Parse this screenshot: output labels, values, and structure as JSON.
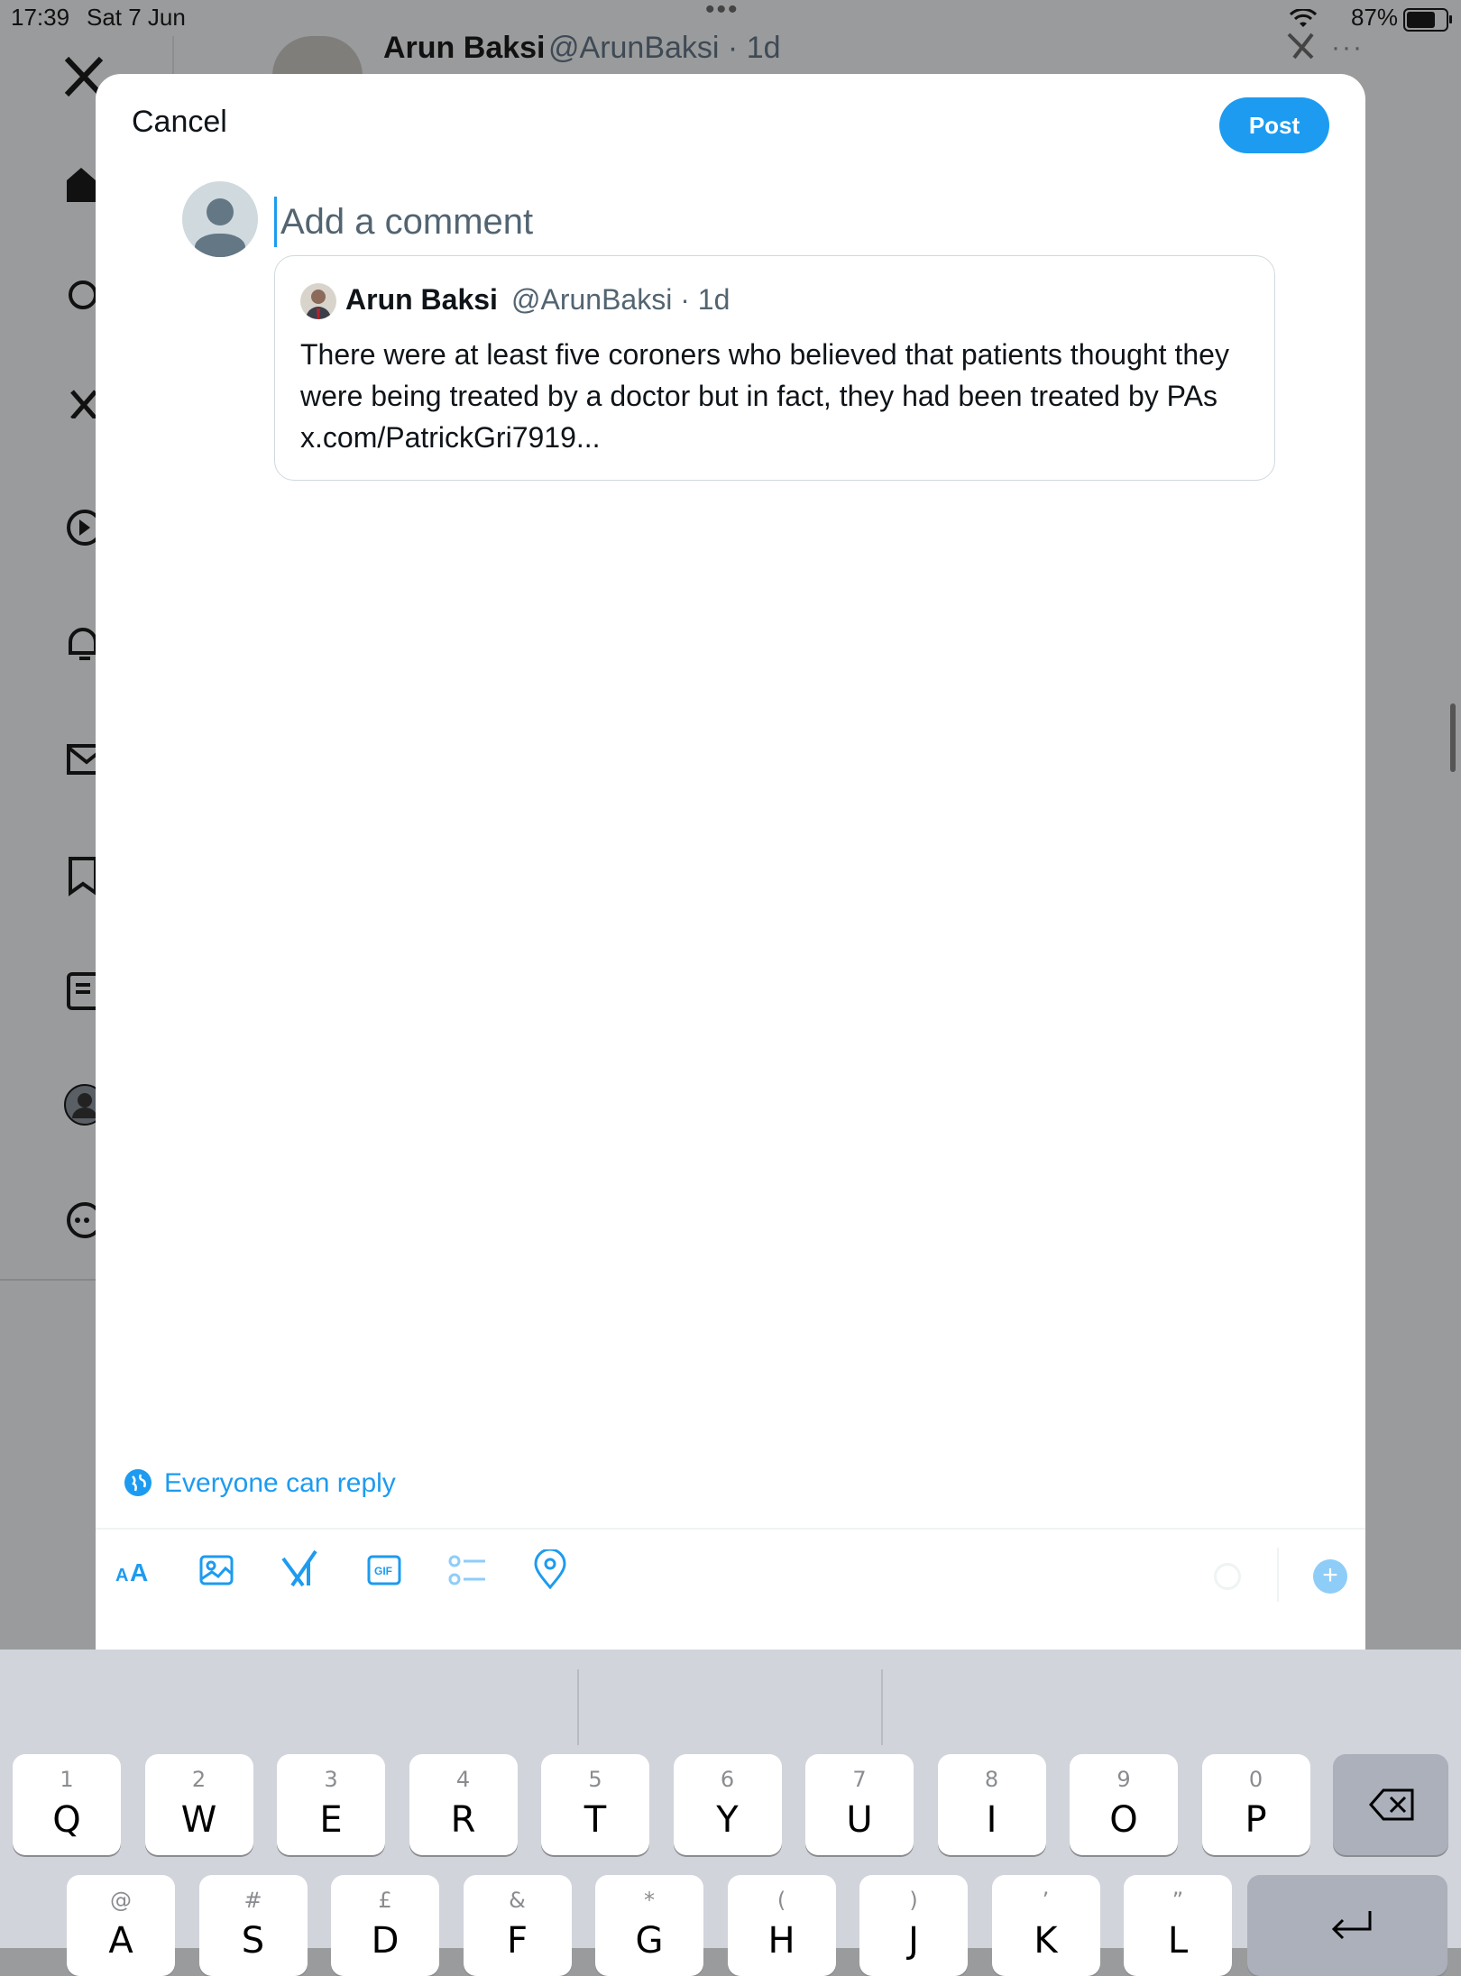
{
  "status_bar": {
    "time": "17:39",
    "date": "Sat 7 Jun",
    "battery_percent": "87%",
    "battery_level": 0.87
  },
  "background_post": {
    "author_name": "Arun Baksi",
    "author_handle": "@ArunBaksi · 1d",
    "more": "···"
  },
  "sidebar": {
    "items": [
      "x-logo-icon",
      "home-icon",
      "search-icon",
      "grok-icon",
      "video-icon",
      "notifications-icon",
      "messages-icon",
      "bookmarks-icon",
      "lists-icon",
      "profile-icon",
      "more-icon"
    ]
  },
  "composer": {
    "cancel_label": "Cancel",
    "post_label": "Post",
    "placeholder": "Add a comment",
    "quoted_post": {
      "author_name": "Arun Baksi",
      "author_handle": "@ArunBaksi · 1d",
      "text": "There were at least five coroners who believed that patients thought they were being treated by a doctor but in fact, they had been treated by PAs x.com/PatrickGri7919..."
    },
    "reply_setting": "Everyone can reply",
    "toolbar": [
      "text-format-icon",
      "image-icon",
      "grok-icon",
      "gif-icon",
      "poll-icon",
      "location-icon"
    ],
    "accent_color": "#1d9bf0"
  },
  "keyboard": {
    "row1": [
      {
        "hint": "1",
        "key": "Q"
      },
      {
        "hint": "2",
        "key": "W"
      },
      {
        "hint": "3",
        "key": "E"
      },
      {
        "hint": "4",
        "key": "R"
      },
      {
        "hint": "5",
        "key": "T"
      },
      {
        "hint": "6",
        "key": "Y"
      },
      {
        "hint": "7",
        "key": "U"
      },
      {
        "hint": "8",
        "key": "I"
      },
      {
        "hint": "9",
        "key": "O"
      },
      {
        "hint": "0",
        "key": "P"
      }
    ],
    "row2": [
      {
        "hint": "@",
        "key": "A"
      },
      {
        "hint": "#",
        "key": "S"
      },
      {
        "hint": "£",
        "key": "D"
      },
      {
        "hint": "&",
        "key": "F"
      },
      {
        "hint": "*",
        "key": "G"
      },
      {
        "hint": "(",
        "key": "H"
      },
      {
        "hint": ")",
        "key": "J"
      },
      {
        "hint": "’",
        "key": "K"
      },
      {
        "hint": "”",
        "key": "L"
      }
    ]
  }
}
